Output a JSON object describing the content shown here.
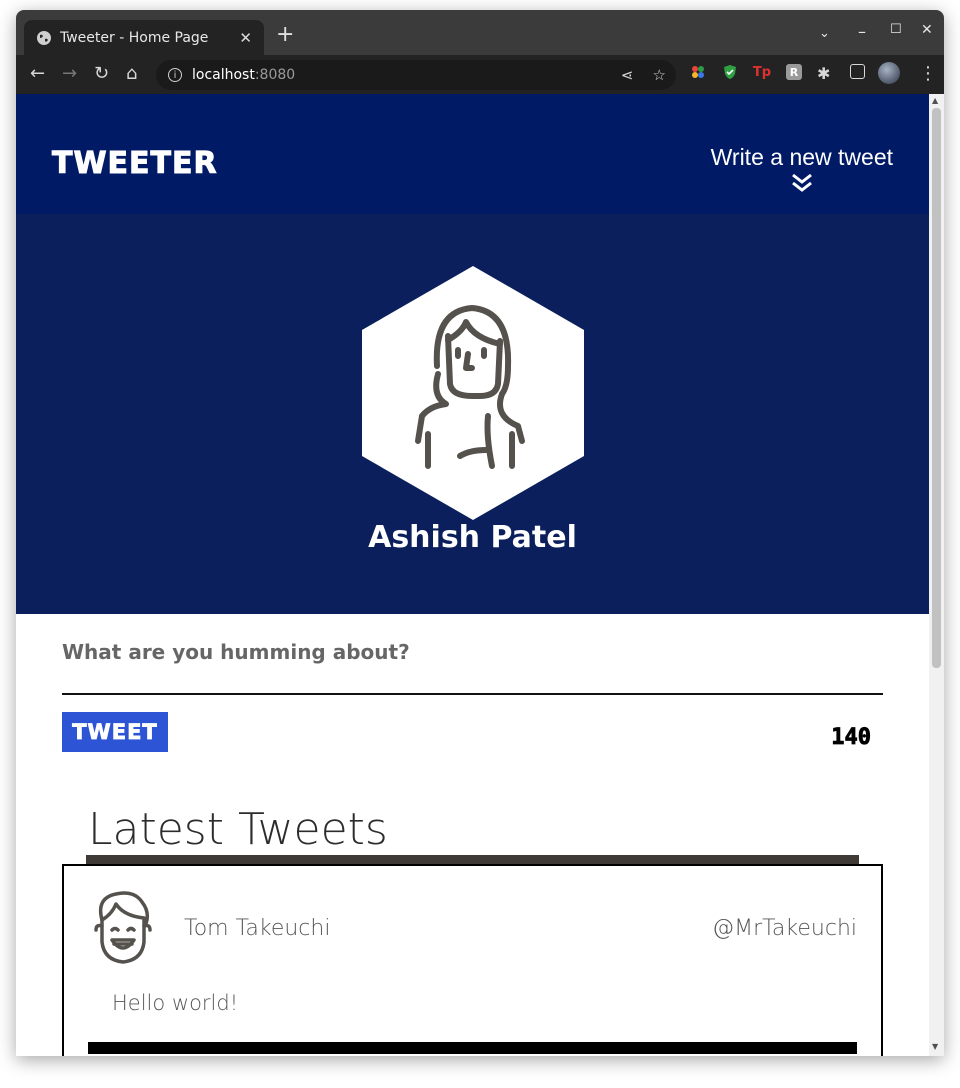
{
  "browser": {
    "tab_title": "Tweeter - Home Page",
    "url_host": "localhost",
    "url_port": ":8080"
  },
  "header": {
    "brand": "TWEETER",
    "compose_link": "Write a new tweet"
  },
  "profile": {
    "name": "Ashish Patel"
  },
  "compose": {
    "prompt": "What are you humming about?",
    "tweet_button": "TWEET",
    "char_counter": "140"
  },
  "feed": {
    "title": "Latest Tweets",
    "tweets": [
      {
        "author": "Tom Takeuchi",
        "handle": "@MrTakeuchi",
        "body": "Hello world!"
      }
    ]
  },
  "colors": {
    "nav_bg": "#001a66",
    "profile_bg": "#0b1f5c",
    "tweet_button": "#2e54d6"
  }
}
